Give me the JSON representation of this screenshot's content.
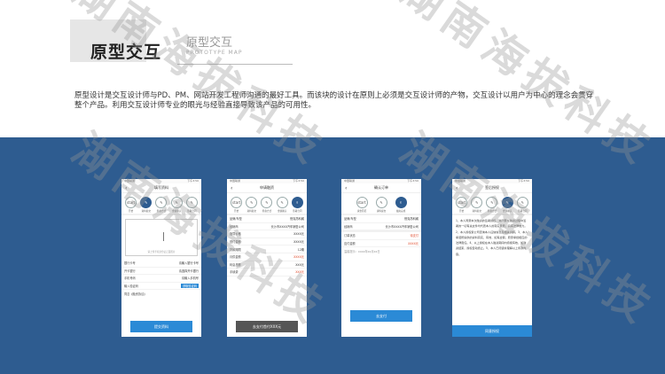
{
  "header": {
    "title": "原型交互",
    "subtitle": "原型交互",
    "subtitle_en": "PROTOTYPE MAP",
    "intro": "原型设计是交互设计师与PD、PM、网站开发工程师沟通的最好工具。而该块的设计在原则上必须是交互设计师的产物，交互设计以用户为中心的理念会贯穿整个产品。利用交互设计师专业的眼光与经验直接导致该产品的可用性。"
  },
  "watermark": "湖南海拔科技",
  "colors": {
    "band": "#2e5c90",
    "accent": "#2b8ad6",
    "warn": "#e04a2b"
  },
  "status": {
    "carrier": "中国联通",
    "time": "下午3:50"
  },
  "steps": [
    "开始",
    "填写资料",
    "签名",
    "确认",
    "完成"
  ],
  "phones": [
    {
      "title": "填写资料",
      "steps": [
        "开始",
        "资料提交",
        "筹备方式",
        "金额确认",
        "签署合同"
      ],
      "rows": [
        {
          "k": "银行卡号",
          "v": "请输入银行卡号"
        },
        {
          "k": "开卡银行",
          "v": "请选择开卡银行"
        },
        {
          "k": "手机号码",
          "v": "请输入手机号"
        },
        {
          "k": "输入验证码",
          "v": "获取验证码"
        }
      ],
      "sign_hint": "请上传手持身份证正面照片",
      "agree": "同意《融资协议》",
      "button": "提交资料"
    },
    {
      "title": "申请融资",
      "rows": [
        {
          "k": "品牌/车型",
          "v": "别克昂科威",
          "red": false
        },
        {
          "k": "经销商",
          "v": "长沙市XXXX汽车销售公司",
          "red": false
        },
        {
          "k": "指导价格",
          "v": "XXXX元",
          "red": false
        },
        {
          "k": "首付金额",
          "v": "XXXX元",
          "red": false
        },
        {
          "k": "贷款期限",
          "v": "12期",
          "red": false
        },
        {
          "k": "月供金额",
          "v": "XXXX元",
          "red": true
        },
        {
          "k": "利息总额",
          "v": "XXX元",
          "red": false
        },
        {
          "k": "手续费",
          "v": "XXX元",
          "red": true
        }
      ],
      "button": "去支付首付XXX元"
    },
    {
      "title": "确认订单",
      "steps": [
        "资金匹配",
        "资料提交",
        "融资完成"
      ],
      "rows": [
        {
          "k": "品牌/车型",
          "v": "别克昂科威",
          "red": false
        },
        {
          "k": "经销商",
          "v": "长沙市XXXX汽车销售公司",
          "red": false
        },
        {
          "k": "订单状态",
          "v": "待支付",
          "red": true
        },
        {
          "k": "应付金额",
          "v": "XXXX元",
          "red": true
        }
      ],
      "note": "温馨提示：xxxx年xx月xx日",
      "button": "去支付"
    },
    {
      "title": "签后授权",
      "doc": "1、本人同意本次融资的签署授权，并同意在融资过程中签署的一切有关文件均代表本人的真实意愿，具有法律效力。2、本人授权贵公司查询本人征信信息及相关资料。3、本人承诺所提供的资料真实、有效，如有虚假，愿意承担相应的法律责任。4、以上授权在本人融资期间内持续有效，如融资结束，授权自动终止。5、本人已阅读并理解以上条款内容。",
      "button": "同意授权"
    }
  ]
}
